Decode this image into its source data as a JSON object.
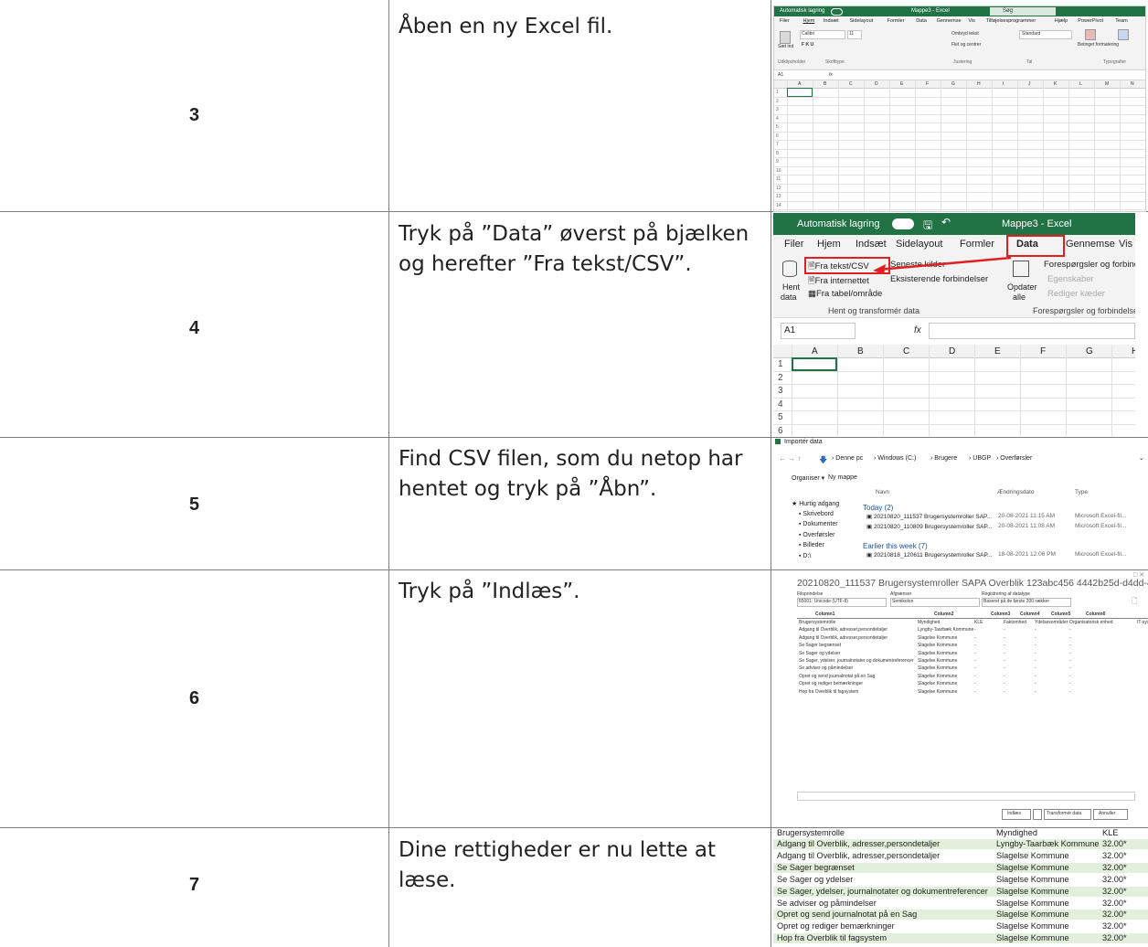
{
  "steps": [
    {
      "number": "3",
      "text": "Åben en ny Excel fil."
    },
    {
      "number": "4",
      "text": "Tryk på ”Data” øverst på bjælken og herefter ”Fra tekst/CSV”."
    },
    {
      "number": "5",
      "text": "Find CSV filen, som du netop har hentet og tryk på ”Åbn”."
    },
    {
      "number": "6",
      "text": "Tryk på ”Indlæs”."
    },
    {
      "number": "7",
      "text": "Dine rettigheder er nu lette at læse."
    }
  ],
  "shot3": {
    "autosave": "Automatisk lagring",
    "title": "Mappe3 - Excel",
    "search": "Søg",
    "tabs": [
      "Filer",
      "Hjem",
      "Indsæt",
      "Sidelayout",
      "Formler",
      "Data",
      "Gennemse",
      "Vis",
      "Tilføjelsesprogrammer",
      "Hjælp",
      "PowerPivot",
      "Team"
    ],
    "font": "Calibri",
    "fontsize": "11",
    "wrap": "Ombryd tekst",
    "merge": "Flet og centrer",
    "numformat": "Standard",
    "cond": "Betinget formatering",
    "astable": "Formatér som tabel",
    "groups": [
      "Udklipsholder",
      "Skrifttype",
      "Justering",
      "Tal",
      "Typografier"
    ],
    "paste": "Sæt ind",
    "cellref": "A1",
    "columns": [
      "A",
      "B",
      "C",
      "D",
      "E",
      "F",
      "G",
      "H",
      "I",
      "J",
      "K",
      "L",
      "M",
      "N"
    ],
    "rows": [
      "1",
      "2",
      "3",
      "4",
      "5",
      "6",
      "7",
      "8",
      "9",
      "10",
      "11",
      "12",
      "13",
      "14",
      "15"
    ]
  },
  "shot4": {
    "autosave": "Automatisk lagring",
    "title": "Mappe3 - Excel",
    "tabs": [
      "Filer",
      "Hjem",
      "Indsæt",
      "Sidelayout",
      "Formler",
      "Data",
      "Gennemse",
      "Vis"
    ],
    "hent": "Hent",
    "data": "data",
    "from_text": "Fra tekst/CSV",
    "recent": "Seneste kilder",
    "from_web": "Fra internettet",
    "existing": "Eksisterende forbindelser",
    "from_table": "Fra tabel/område",
    "group1": "Hent og transformér data",
    "refresh": "Opdater",
    "all": "alle",
    "queries": "Forespørgsler og forbindelser",
    "properties": "Egenskaber",
    "edit_links": "Rediger kæder",
    "group2": "Forespørgsler og forbindelser",
    "cellref": "A1",
    "fx": "fx",
    "columns": [
      "A",
      "B",
      "C",
      "D",
      "E",
      "F",
      "G",
      "H"
    ],
    "rows": [
      "1",
      "2",
      "3",
      "4",
      "5",
      "6"
    ]
  },
  "shot5": {
    "title": "Importér data",
    "path": [
      "Denne pc",
      "Windows (C:)",
      "Brugere",
      "UBGP",
      "Overførsler"
    ],
    "organize": "Organiser",
    "new_folder": "Ny mappe",
    "col_name": "Navn",
    "col_date": "Ændringsdato",
    "col_type": "Type",
    "nav": [
      "Hurtig adgang",
      "Skrivebord",
      "Dokumenter",
      "Overførsler",
      "Billeder",
      "D:\\"
    ],
    "group_today": "Today (2)",
    "group_week": "Earlier this week (7)",
    "files": [
      {
        "name": "20210820_111537 Brugersystemroller SAP...",
        "date": "20-08-2021 11:15 AM",
        "type": "Microsoft Excel-fil..."
      },
      {
        "name": "20210820_110809 Brugersystemroller SAP...",
        "date": "20-08-2021 11:08 AM",
        "type": "Microsoft Excel-fil..."
      },
      {
        "name": "20210818_120611 Brugersystemroller SAP...",
        "date": "18-08-2021 12:06 PM",
        "type": "Microsoft Excel-fil..."
      }
    ]
  },
  "shot6": {
    "title": "20210820_111537 Brugersystemroller SAPA Overblik 123abc456 4442b25d-d4dd-4be5-90bf-156...",
    "origin_label": "Filoprindelse",
    "origin_value": "65001: Unicode (UTF-8)",
    "delim_label": "Afgrænser",
    "delim_value": "Semikolon",
    "detect_label": "Registrering af datatype",
    "detect_value": "Baseret på de første 200 rækker",
    "headers": [
      "Column1",
      "Column2",
      "Column3",
      "Column4",
      "Column5",
      "Column6"
    ],
    "rows": [
      [
        "Brugersystemrolle",
        "Myndighed",
        "KLE",
        "Faktomhed",
        "Ydelsesområder",
        "Organisatorisk enhed"
      ],
      [
        "Adgang til Overblik, adresser,persondetaljer",
        "Lyngby-Taarbæk Kommune",
        "-",
        "-",
        "-",
        "-"
      ],
      [
        "Adgang til Overblik, adresser,persondetaljer",
        "Slagelse Kommune",
        "-",
        "-",
        "-",
        "-"
      ],
      [
        "Se Sager begrænset",
        "Slagelse Kommune",
        "-",
        "-",
        "-",
        "-"
      ],
      [
        "Se Sager og ydelser",
        "Slagelse Kommune",
        "-",
        "-",
        "-",
        "-"
      ],
      [
        "Se Sager, ydelser, journalnotater og dokumentreferencer",
        "Slagelse Kommune",
        "-",
        "-",
        "-",
        "-"
      ],
      [
        "Se adviser og påmindelser",
        "Slagelse Kommune",
        "-",
        "-",
        "-",
        "-"
      ],
      [
        "Opret og send journalnotat på en Sag",
        "Slagelse Kommune",
        "-",
        "-",
        "-",
        "-"
      ],
      [
        "Opret og rediger bemærkninger",
        "Slagelse Kommune",
        "-",
        "-",
        "-",
        "-"
      ],
      [
        "Hop fra Overblik til fagsystem",
        "Slagelse Kommune",
        "-",
        "-",
        "-",
        "-"
      ]
    ],
    "extra_col": "IT-syste",
    "load": "Indlæs",
    "transform": "Transformér data",
    "cancel": "Annuller"
  },
  "shot7": {
    "headers": [
      "Brugersystemrolle",
      "Myndighed",
      "KLE"
    ],
    "rows": [
      [
        "Adgang til Overblik, adresser,persondetaljer",
        "Lyngby-Taarbæk Kommune",
        "32.00*"
      ],
      [
        "Adgang til Overblik, adresser,persondetaljer",
        "Slagelse Kommune",
        "32.00*"
      ],
      [
        "Se Sager begrænset",
        "Slagelse Kommune",
        "32.00*"
      ],
      [
        "Se Sager og ydelser",
        "Slagelse Kommune",
        "32.00*"
      ],
      [
        "Se Sager, ydelser, journalnotater og dokumentreferencer",
        "Slagelse Kommune",
        "32.00*"
      ],
      [
        "Se adviser og påmindelser",
        "Slagelse Kommune",
        "32.00*"
      ],
      [
        "Opret og send journalnotat på en Sag",
        "Slagelse Kommune",
        "32.00*"
      ],
      [
        "Opret og rediger bemærkninger",
        "Slagelse Kommune",
        "32.00*"
      ],
      [
        "Hop fra Overblik til fagsystem",
        "Slagelse Kommune",
        "32.00*"
      ]
    ]
  }
}
